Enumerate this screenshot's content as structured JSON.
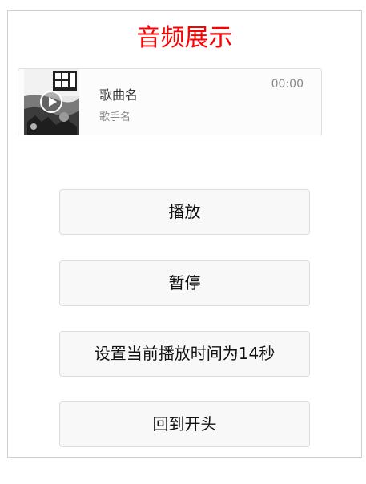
{
  "page": {
    "title": "音频展示",
    "title_color": "#ff0000"
  },
  "audio": {
    "song_name": "歌曲名",
    "singer": "歌手名",
    "time": "00:00",
    "cover_icon": "album-cover-image",
    "play_icon": "play-icon"
  },
  "buttons": [
    {
      "label": "播放"
    },
    {
      "label": "暂停"
    },
    {
      "label": "设置当前播放时间为14秒"
    },
    {
      "label": "回到开头"
    }
  ]
}
